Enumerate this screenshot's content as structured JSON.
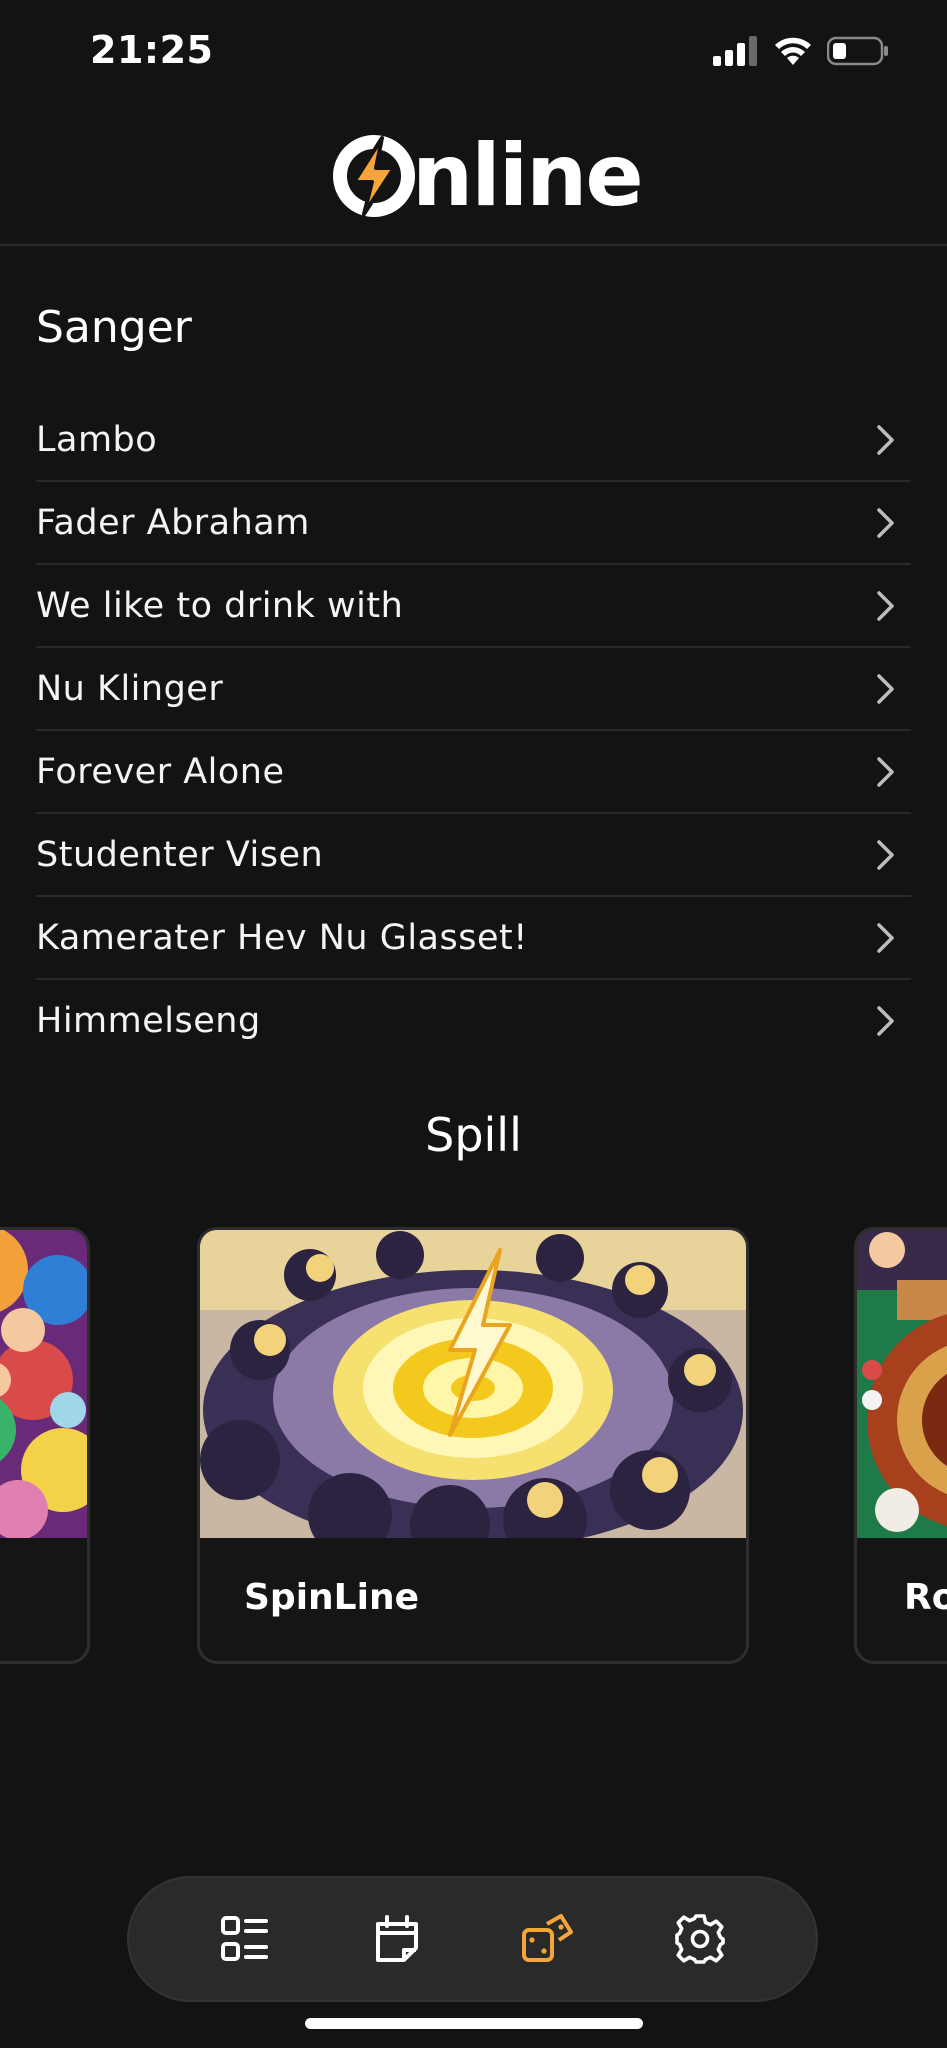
{
  "status": {
    "time": "21:25"
  },
  "app": {
    "logo_text": "nline",
    "accent_color": "#f6a53a"
  },
  "songs": {
    "title": "Sanger",
    "items": [
      {
        "label": "Lambo"
      },
      {
        "label": "Fader Abraham"
      },
      {
        "label": "We like to drink with"
      },
      {
        "label": "Nu Klinger"
      },
      {
        "label": "Forever Alone"
      },
      {
        "label": "Studenter Visen"
      },
      {
        "label": "Kamerater Hev Nu Glasset!"
      },
      {
        "label": "Himmelseng"
      }
    ]
  },
  "games": {
    "title": "Spill",
    "cards": [
      {
        "label": ""
      },
      {
        "label": "SpinLine"
      },
      {
        "label": "Ro"
      }
    ]
  },
  "nav": {
    "items": [
      {
        "icon": "list-icon",
        "active": false
      },
      {
        "icon": "calendar-icon",
        "active": false
      },
      {
        "icon": "dice-icon",
        "active": true
      },
      {
        "icon": "gear-icon",
        "active": false
      }
    ]
  }
}
